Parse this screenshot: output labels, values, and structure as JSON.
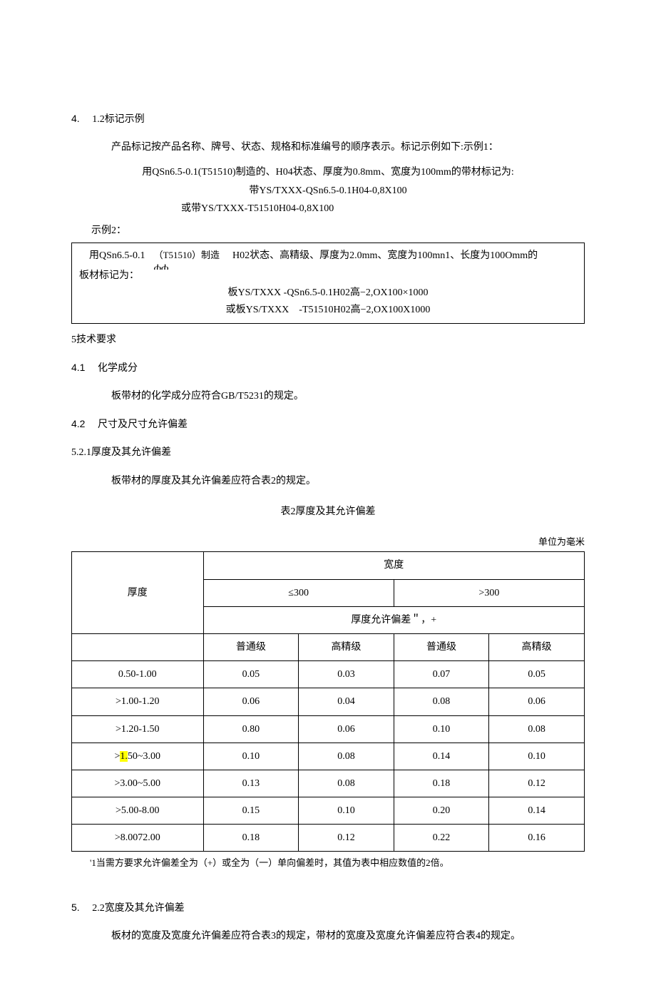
{
  "s412": {
    "num": "4.",
    "num2": "1.2",
    "title": "标记示例",
    "intro": "产品标记按产品名称、牌号、状态、规格和标准编号的顺序表示。标记示例如下:示例1：",
    "ex1_line1": "用QSn6.5-0.1(T51510)制造的、H04状态、厚度为0.8mm、宽度为100mm的带材标记为:",
    "ex1_line2": "带YS/TXXX-QSn6.5-0.1H04-0,8X100",
    "ex1_line3": "或带YS/TXXX-T51510H04-0,8X100",
    "ex2_label": "示例2：",
    "ex2_col1": "用QSn6.5-0.1",
    "ex2_col2a": "（T51510）制造",
    "ex2_col2b": "ሐሐ",
    "ex2_col3": "H02状态、高精级、厚度为2.0mm、宽度为100mn1、长度为100Omm的",
    "ex2_line2": "板材标记为：",
    "ex2_center1": "板YS/TXXX -QSn6.5-0.1H02高−2,OX100×1000",
    "ex2_center2": "或板YS/TXXX    -T51510H02高−2,OX100X1000"
  },
  "s5": {
    "title": "5技术要求"
  },
  "s41": {
    "num": "4.1",
    "title": "化学成分",
    "body": "板带材的化学成分应符合GB/T5231的规定。"
  },
  "s42": {
    "num": "4.2",
    "title": "尺寸及尺寸允许偏差"
  },
  "s521": {
    "title": "5.2.1厚度及其允许偏差",
    "body": "板带材的厚度及其允许偏差应符合表2的规定。",
    "caption": "表2厚度及其允许偏差",
    "unit": "单位为毫米",
    "note": "'1当需方要求允许偏差全为（+）或全为（一）单向偏差时，其值为表中相应数值的2倍。"
  },
  "tol_table": {
    "h_thickness": "厚度",
    "h_width": "宽度",
    "h_le300": "≤300",
    "h_gt300": ">300",
    "h_allow": "厚度允许偏差＂，+",
    "h_normal": "普通级",
    "h_high": "高精级"
  },
  "chart_data": {
    "type": "table",
    "columns": [
      "厚度",
      "≤300 普通级",
      "≤300 高精级",
      ">300 普通级",
      ">300 高精级"
    ],
    "rows": [
      {
        "thk": "0.50-1.00",
        "a": "0.05",
        "b": "0.03",
        "c": "0.07",
        "d": "0.05"
      },
      {
        "thk": ">1.00-1.20",
        "a": "0.06",
        "b": "0.04",
        "c": "0.08",
        "d": "0.06"
      },
      {
        "thk": ">1.20-1.50",
        "a": "0.80",
        "b": "0.06",
        "c": "0.10",
        "d": "0.08"
      },
      {
        "thk_pre": ">",
        "thk_hl": "1.",
        "thk_post": "50~3.00",
        "a": "0.10",
        "b": "0.08",
        "c": "0.14",
        "d": "0.10"
      },
      {
        "thk": ">3.00~5.00",
        "a": "0.13",
        "b": "0.08",
        "c": "0.18",
        "d": "0.12"
      },
      {
        "thk": ">5.00-8.00",
        "a": "0.15",
        "b": "0.10",
        "c": "0.20",
        "d": "0.14"
      },
      {
        "thk": ">8.0072.00",
        "a": "0.18",
        "b": "0.12",
        "c": "0.22",
        "d": "0.16"
      }
    ]
  },
  "s522": {
    "num": "5.",
    "num2": "2.2",
    "title": "宽度及其允许偏差",
    "body": "板材的宽度及宽度允许偏差应符合表3的规定，带材的宽度及宽度允许偏差应符合表4的规定。"
  }
}
